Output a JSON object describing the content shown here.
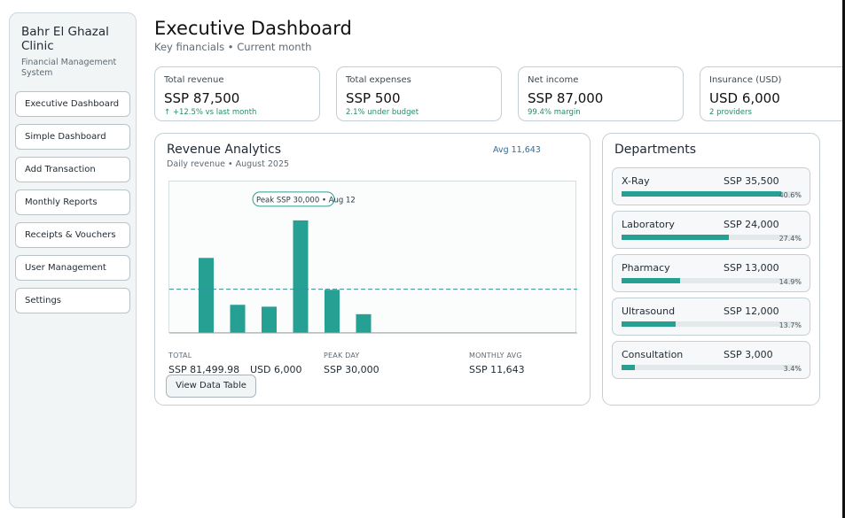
{
  "sidebar": {
    "brand": "Bahr El Ghazal Clinic",
    "subtitle": "Financial Management System",
    "items": [
      {
        "label": "Executive Dashboard"
      },
      {
        "label": "Simple Dashboard"
      },
      {
        "label": "Add Transaction"
      },
      {
        "label": "Monthly Reports"
      },
      {
        "label": "Receipts & Vouchers"
      },
      {
        "label": "User Management"
      },
      {
        "label": "Settings"
      }
    ]
  },
  "header": {
    "title": "Executive Dashboard",
    "subtitle": "Key financials • Current month"
  },
  "kpis": [
    {
      "label": "Total revenue",
      "value": "SSP 87,500",
      "note": "↑ +12.5% vs last month"
    },
    {
      "label": "Total expenses",
      "value": "SSP 500",
      "note": "2.1% under budget"
    },
    {
      "label": "Net income",
      "value": "SSP 87,000",
      "note": "99.4% margin"
    },
    {
      "label": "Insurance (USD)",
      "value": "USD 6,000",
      "note": "2 providers"
    }
  ],
  "revenue": {
    "title": "Revenue Analytics",
    "subtitle": "Daily revenue • August 2025",
    "avg_link": "Avg 11,643",
    "peak_label": "Peak SSP 30,000 • Aug 12",
    "stats": {
      "total_label": "TOTAL",
      "total_ssp": "SSP 81,499.98",
      "total_usd": "USD 6,000",
      "peak_label": "PEAK DAY",
      "peak_value": "SSP 30,000",
      "avg_label": "MONTHLY AVG",
      "avg_value": "SSP 11,643"
    },
    "view_button": "View Data Table"
  },
  "chart_data": {
    "type": "bar",
    "title": "Revenue Analytics",
    "subtitle": "Daily revenue • August 2025",
    "values": [
      20000,
      7500,
      7000,
      30000,
      11500,
      5000
    ],
    "average": 11643,
    "ylim": [
      0,
      38000
    ],
    "grid": false,
    "bar_color": "#26a092",
    "avg_line_color": "#2f8fa0"
  },
  "departments": {
    "title": "Departments",
    "items": [
      {
        "name": "X-Ray",
        "amount": "SSP 35,500",
        "pct": "40.6%",
        "share": 0.406
      },
      {
        "name": "Laboratory",
        "amount": "SSP 24,000",
        "pct": "27.4%",
        "share": 0.274
      },
      {
        "name": "Pharmacy",
        "amount": "SSP 13,000",
        "pct": "14.9%",
        "share": 0.149
      },
      {
        "name": "Ultrasound",
        "amount": "SSP 12,000",
        "pct": "13.7%",
        "share": 0.137
      },
      {
        "name": "Consultation",
        "amount": "SSP 3,000",
        "pct": "3.4%",
        "share": 0.034
      }
    ]
  },
  "colors": {
    "accent": "#26a092",
    "positive": "#2a8a6a",
    "link": "#2f6f9a"
  }
}
